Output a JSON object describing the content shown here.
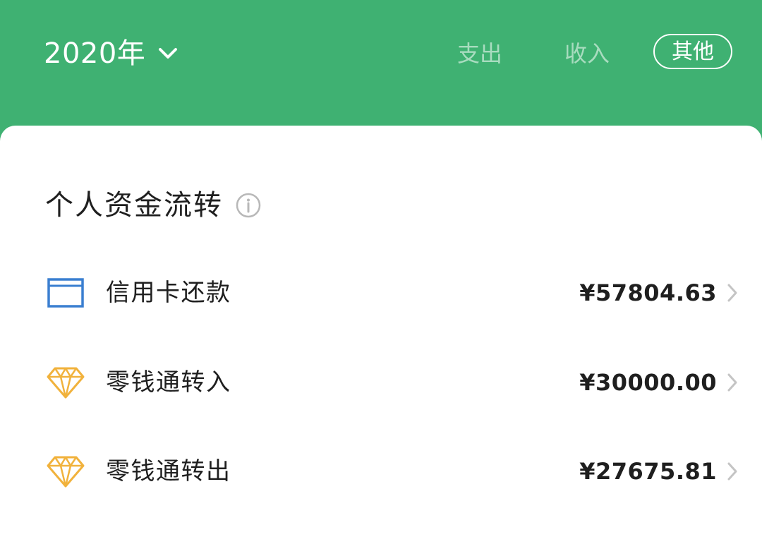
{
  "header": {
    "year_label": "2020年",
    "tabs": {
      "expense": "支出",
      "income": "收入",
      "other": "其他"
    },
    "colors": {
      "background": "#3fb172",
      "active_tab_border": "#ffffff",
      "inactive_tab_text": "rgba(255,255,255,0.55)"
    }
  },
  "section": {
    "title": "个人资金流转",
    "info_icon": "info-circle-icon"
  },
  "rows": [
    {
      "label": "信用卡还款",
      "amount": "¥57804.63",
      "icon": "credit-card-icon",
      "icon_color": "#3a7fd0"
    },
    {
      "label": "零钱通转入",
      "amount": "¥30000.00",
      "icon": "diamond-icon",
      "icon_color": "#f1b23c"
    },
    {
      "label": "零钱通转出",
      "amount": "¥27675.81",
      "icon": "diamond-icon",
      "icon_color": "#f1b23c"
    }
  ]
}
